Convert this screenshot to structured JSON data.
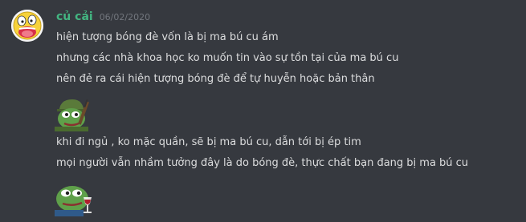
{
  "message": {
    "username": "củ cải",
    "timestamp": "06/02/2020",
    "lines": [
      "hiện tượng bóng đè vốn là bị ma bú cu ám",
      "nhưng các nhà khoa học ko muốn tin vào sự tồn tại của ma bú cu",
      "nên đẻ ra cái hiện tượng bóng đè để tự huyễn hoặc bản thân",
      "khi đi ngủ , ko mặc quần, sẽ bị ma bú cu, dẫn tới bị ép tim",
      "mọi người vẫn nhầm tưởng đây là do bóng đè, thực chất bạn đang bị ma bú cu"
    ],
    "emojis": [
      "pepe-soldier-emoji",
      "pepe-wine-emoji"
    ]
  },
  "colors": {
    "background": "#36393f",
    "username": "#43b581",
    "text": "#dcddde",
    "timestamp": "#72767d"
  }
}
